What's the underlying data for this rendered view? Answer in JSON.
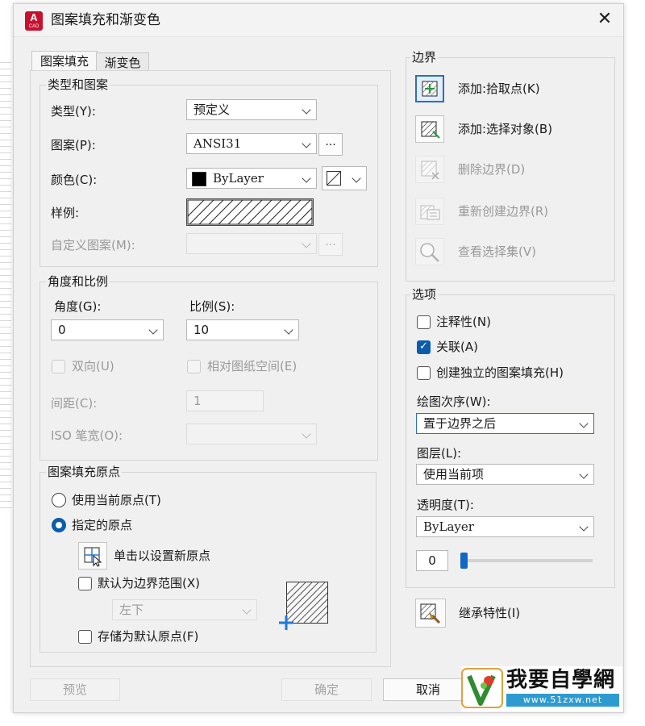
{
  "window": {
    "title": "图案填充和渐变色",
    "app_icon_letter": "A",
    "app_icon_sub": "CAD",
    "close_glyph": "✕"
  },
  "tabs": [
    {
      "label": "图案填充"
    },
    {
      "label": "渐变色"
    }
  ],
  "type_pattern": {
    "legend": "类型和图案",
    "type_label": "类型(Y):",
    "type_value": "预定义",
    "pattern_label": "图案(P):",
    "pattern_value": "ANSI31",
    "pattern_browse": "...",
    "color_label": "颜色(C):",
    "color_value": "ByLayer",
    "color_swatch": "#000000",
    "sample_label": "样例:",
    "custom_label": "自定义图案(M):",
    "custom_browse": "..."
  },
  "angle_scale": {
    "legend": "角度和比例",
    "angle_label": "角度(G):",
    "angle_value": "0",
    "scale_label": "比例(S):",
    "scale_value": "10",
    "double_label": "双向(U)",
    "relative_label": "相对图纸空间(E)",
    "spacing_label": "间距(C):",
    "spacing_value": "1",
    "iso_label": "ISO 笔宽(O):"
  },
  "origin": {
    "legend": "图案填充原点",
    "use_current_label": "使用当前原点(T)",
    "specified_label": "指定的原点",
    "click_set_label": "单击以设置新原点",
    "default_extent_label": "默认为边界范围(X)",
    "position_value": "左下",
    "store_default_label": "存储为默认原点(F)"
  },
  "boundary": {
    "legend": "边界",
    "add_pick_label": "添加:拾取点(K)",
    "add_select_label": "添加:选择对象(B)",
    "remove_label": "删除边界(D)",
    "recreate_label": "重新创建边界(R)",
    "view_sel_label": "查看选择集(V)"
  },
  "options": {
    "legend": "选项",
    "annotative_label": "注释性(N)",
    "associative_label": "关联(A)",
    "separate_label": "创建独立的图案填充(H)",
    "draw_order_label": "绘图次序(W):",
    "draw_order_value": "置于边界之后",
    "layer_label": "图层(L):",
    "layer_value": "使用当前项",
    "transparency_label": "透明度(T):",
    "transparency_value": "ByLayer",
    "transparency_amount": "0",
    "transparency_fraction": 0
  },
  "inherit_label": "继承特性(I)",
  "buttons": {
    "preview": "预览",
    "ok": "确定",
    "cancel": "取消"
  },
  "watermark": {
    "text": "我要自學網",
    "url": "www.51zxw.net",
    "letter": "V"
  }
}
